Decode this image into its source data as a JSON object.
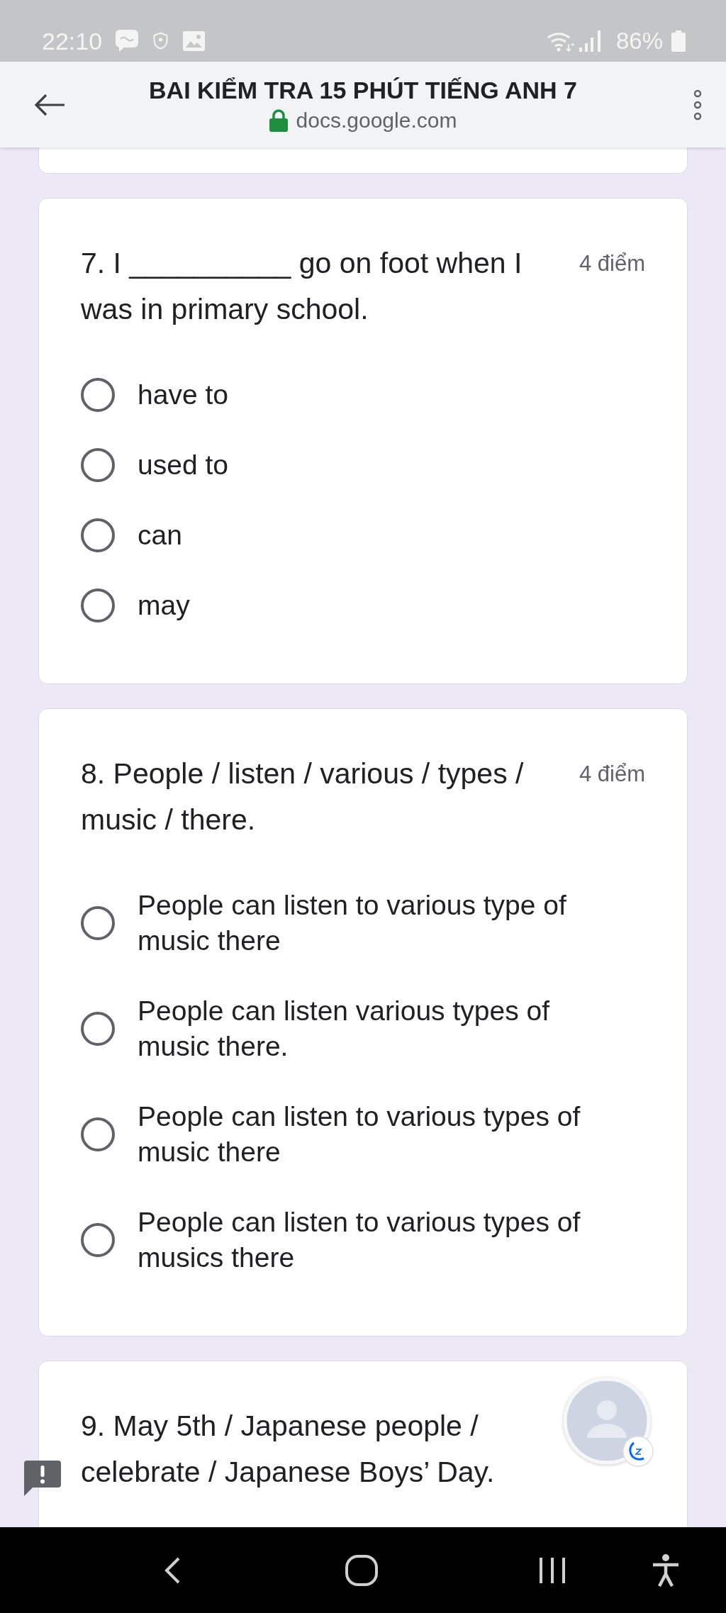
{
  "status_bar": {
    "time": "22:10",
    "battery": "86%"
  },
  "header": {
    "title": "BAI KIỂM TRA 15 PHÚT TIẾNG ANH 7",
    "url": "docs.google.com"
  },
  "questions": [
    {
      "text": "7. I __________ go on foot when I was in primary school.",
      "points": "4 điểm",
      "options": [
        {
          "label": "have to",
          "selected": false
        },
        {
          "label": "used to",
          "selected": false
        },
        {
          "label": "can",
          "selected": false
        },
        {
          "label": "may",
          "selected": false
        }
      ]
    },
    {
      "text": "8. People / listen / various / types / music / there.",
      "points": "4 điểm",
      "options": [
        {
          "label": "People can listen to various type of music there",
          "selected": false
        },
        {
          "label": "People can listen various types of music there.",
          "selected": false
        },
        {
          "label": "People can listen to various types of music there",
          "selected": false
        },
        {
          "label": "People can listen to various types of musics there",
          "selected": false
        }
      ]
    },
    {
      "text": "9. May 5th / Japanese people / celebrate / Japanese Boys’ Day."
    }
  ]
}
